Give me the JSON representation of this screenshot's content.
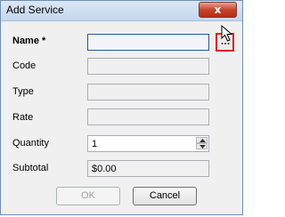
{
  "window": {
    "title": "Add Service",
    "close_glyph": "x"
  },
  "form": {
    "name": {
      "label": "Name *",
      "value": ""
    },
    "code": {
      "label": "Code",
      "value": ""
    },
    "type": {
      "label": "Type",
      "value": ""
    },
    "rate": {
      "label": "Rate",
      "value": ""
    },
    "quantity": {
      "label": "Quantity",
      "value": "1"
    },
    "subtotal": {
      "label": "Subtotal",
      "value": "$0.00"
    }
  },
  "buttons": {
    "ok": "OK",
    "cancel": "Cancel"
  },
  "browse_icon": "ellipsis-icon",
  "colors": {
    "focus_border": "#2b5797",
    "highlight": "#e0201b",
    "close_red": "#c7432c"
  }
}
